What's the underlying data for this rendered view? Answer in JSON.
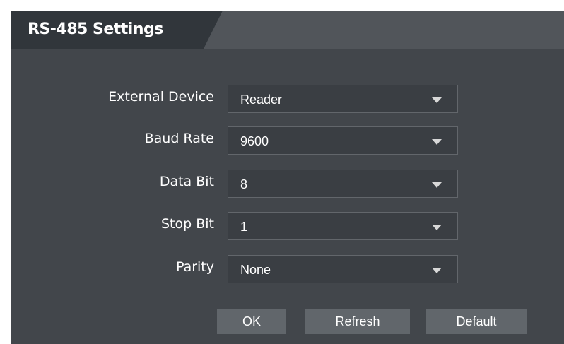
{
  "header": {
    "title": "RS-485 Settings"
  },
  "form": {
    "fields": [
      {
        "label": "External Device",
        "value": "Reader"
      },
      {
        "label": "Baud Rate",
        "value": "9600"
      },
      {
        "label": "Data Bit",
        "value": "8"
      },
      {
        "label": "Stop Bit",
        "value": "1"
      },
      {
        "label": "Parity",
        "value": "None"
      }
    ]
  },
  "actions": {
    "ok_label": "OK",
    "refresh_label": "Refresh",
    "default_label": "Default"
  },
  "icons": {
    "dropdown": "chevron-down-icon"
  },
  "colors": {
    "panel_bg": "#42464b",
    "tab_active": "#31363b",
    "tab_strip": "#51555a",
    "button_bg": "#61666b",
    "text": "#ffffff"
  }
}
